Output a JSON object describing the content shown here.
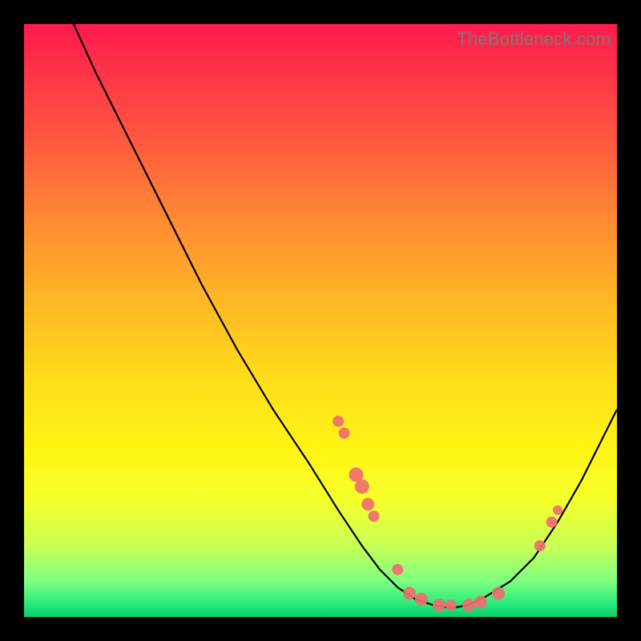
{
  "watermark": "TheBottleneck.com",
  "colors": {
    "frame_bg_top": "#ff1a4d",
    "frame_bg_bottom": "#0ccf66",
    "curve": "#000000",
    "dot": "#ef6e6e",
    "page_bg": "#000000",
    "watermark_text": "#7a7a7a"
  },
  "chart_data": {
    "type": "line",
    "title": "",
    "xlabel": "",
    "ylabel": "",
    "xlim": [
      0,
      100
    ],
    "ylim": [
      0,
      100
    ],
    "grid": false,
    "legend": false,
    "series": [
      {
        "name": "curve",
        "x": [
          7,
          12,
          18,
          24,
          30,
          36,
          42,
          48,
          53,
          57,
          60,
          63,
          66,
          69,
          72,
          75,
          78,
          82,
          86,
          90,
          94,
          98,
          100
        ],
        "y": [
          103,
          92,
          80,
          68,
          56,
          45,
          35,
          26,
          18,
          12,
          8,
          5,
          3,
          2,
          1.5,
          2,
          3.5,
          6,
          10,
          16,
          23,
          31,
          35
        ]
      }
    ],
    "markers": [
      {
        "name": "dot",
        "x": 53,
        "y": 33,
        "r": 7
      },
      {
        "name": "dot",
        "x": 54,
        "y": 31,
        "r": 7
      },
      {
        "name": "dot",
        "x": 56,
        "y": 24,
        "r": 9
      },
      {
        "name": "dot",
        "x": 57,
        "y": 22,
        "r": 9
      },
      {
        "name": "dot",
        "x": 58,
        "y": 19,
        "r": 8
      },
      {
        "name": "dot",
        "x": 59,
        "y": 17,
        "r": 7
      },
      {
        "name": "dot",
        "x": 63,
        "y": 8,
        "r": 7
      },
      {
        "name": "dot",
        "x": 65,
        "y": 4,
        "r": 8
      },
      {
        "name": "dot",
        "x": 67,
        "y": 3,
        "r": 8
      },
      {
        "name": "dot",
        "x": 70,
        "y": 2,
        "r": 8
      },
      {
        "name": "dot",
        "x": 72,
        "y": 2,
        "r": 7
      },
      {
        "name": "dot",
        "x": 75,
        "y": 2,
        "r": 8
      },
      {
        "name": "dot",
        "x": 77,
        "y": 2.5,
        "r": 8
      },
      {
        "name": "dot",
        "x": 80,
        "y": 4,
        "r": 8
      },
      {
        "name": "dot",
        "x": 87,
        "y": 12,
        "r": 7
      },
      {
        "name": "dot",
        "x": 89,
        "y": 16,
        "r": 7
      },
      {
        "name": "dot",
        "x": 90,
        "y": 18,
        "r": 6
      }
    ]
  }
}
